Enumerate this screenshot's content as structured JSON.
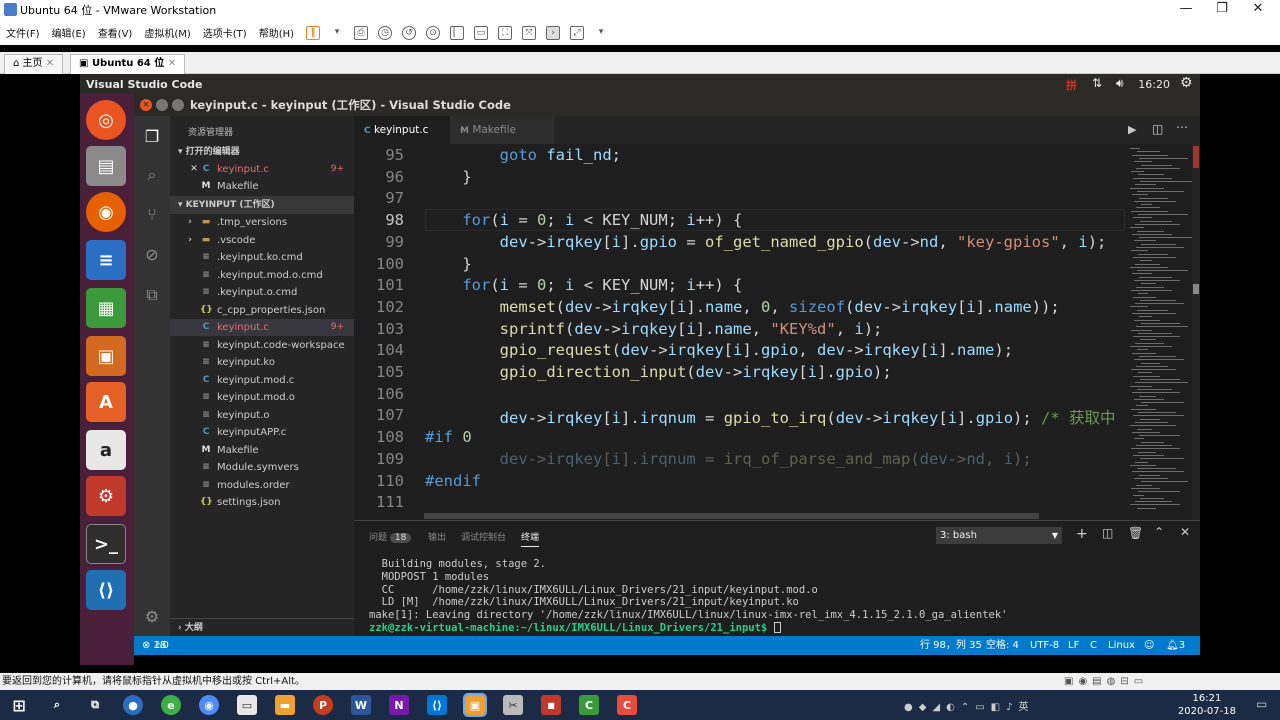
{
  "vmware": {
    "title": "Ubuntu 64 位 - VMware Workstation",
    "menu": [
      "文件(F)",
      "编辑(E)",
      "查看(V)",
      "虚拟机(M)",
      "选项卡(T)",
      "帮助(H)"
    ],
    "tabs": [
      {
        "label": "主页"
      },
      {
        "label": "Ubuntu 64 位"
      }
    ],
    "status_hint": "要返回到您的计算机，请将鼠标指针从虚拟机中移出或按 Ctrl+Alt。"
  },
  "ubuntu": {
    "app_name": "Visual Studio Code",
    "time": "16:20"
  },
  "vscode": {
    "window_title": "keyinput.c - keyinput (工作区) - Visual Studio Code",
    "explorer_header": "资源管理器",
    "open_editors_label": "打开的编辑器",
    "open_editors": [
      {
        "name": "keyinput.c",
        "badge": "9+",
        "icon": "C"
      },
      {
        "name": "Makefile",
        "icon": "M"
      }
    ],
    "workspace_label": "KEYINPUT (工作区)",
    "files": [
      {
        "name": ".tmp_versions",
        "icon": "folder",
        "arrow": "›"
      },
      {
        "name": ".vscode",
        "icon": "folder",
        "arrow": "›"
      },
      {
        "name": ".keyinput.ko.cmd",
        "icon": "file"
      },
      {
        "name": ".keyinput.mod.o.cmd",
        "icon": "file"
      },
      {
        "name": ".keyinput.o.cmd",
        "icon": "file"
      },
      {
        "name": "c_cpp_properties.json",
        "icon": "json"
      },
      {
        "name": "keyinput.c",
        "icon": "C",
        "badge": "9+"
      },
      {
        "name": "keyinput.code-workspace",
        "icon": "file"
      },
      {
        "name": "keyinput.ko",
        "icon": "file"
      },
      {
        "name": "keyinput.mod.c",
        "icon": "C"
      },
      {
        "name": "keyinput.mod.o",
        "icon": "file"
      },
      {
        "name": "keyinput.o",
        "icon": "file"
      },
      {
        "name": "keyinputAPP.c",
        "icon": "C"
      },
      {
        "name": "Makefile",
        "icon": "M"
      },
      {
        "name": "Module.symvers",
        "icon": "file"
      },
      {
        "name": "modules.order",
        "icon": "file"
      },
      {
        "name": "settings.json",
        "icon": "json"
      }
    ],
    "outline_label": "大纲",
    "editor_tabs": [
      {
        "label": "keyinput.c",
        "icon": "C"
      },
      {
        "label": "Makefile",
        "icon": "M"
      }
    ],
    "code_lines": [
      {
        "n": "95",
        "text": "        goto fail_nd;"
      },
      {
        "n": "96",
        "text": "    }"
      },
      {
        "n": "97",
        "text": ""
      },
      {
        "n": "98",
        "text": "    for(i = 0; i < KEY_NUM; i++) {"
      },
      {
        "n": "99",
        "text": "        dev->irqkey[i].gpio = of_get_named_gpio(dev->nd, \"key-gpios\", i);"
      },
      {
        "n": "100",
        "text": "    }"
      },
      {
        "n": "101",
        "text": "    for(i = 0; i < KEY_NUM; i++) {"
      },
      {
        "n": "102",
        "text": "        memset(dev->irqkey[i].name, 0, sizeof(dev->irqkey[i].name));"
      },
      {
        "n": "103",
        "text": "        sprintf(dev->irqkey[i].name, \"KEY%d\", i);"
      },
      {
        "n": "104",
        "text": "        gpio_request(dev->irqkey[i].gpio, dev->irqkey[i].name);"
      },
      {
        "n": "105",
        "text": "        gpio_direction_input(dev->irqkey[i].gpio);"
      },
      {
        "n": "106",
        "text": ""
      },
      {
        "n": "107",
        "text": "        dev->irqkey[i].irqnum = gpio_to_irq(dev->irqkey[i].gpio); /* 获取中"
      },
      {
        "n": "108",
        "text": "#if 0"
      },
      {
        "n": "109",
        "text": "        dev->irqkey[i].irqnum = irq_of_parse_and_map(dev->nd, i);"
      },
      {
        "n": "110",
        "text": "#endif"
      },
      {
        "n": "111",
        "text": ""
      }
    ],
    "panel": {
      "tabs": [
        "问题",
        "输出",
        "调试控制台",
        "终端"
      ],
      "problems_count": "18",
      "terminal_select": "3: bash",
      "terminal_lines": [
        "  Building modules, stage 2.",
        "  MODPOST 1 modules",
        "  CC      /home/zzk/linux/IMX6ULL/Linux_Drivers/21_input/keyinput.mod.o",
        "  LD [M]  /home/zzk/linux/IMX6ULL/Linux_Drivers/21_input/keyinput.ko",
        "make[1]: Leaving directory '/home/zzk/linux/IMX6ULL/linux/linux-imx-rel_imx_4.1.15_2.1.0_ga_alientek'"
      ],
      "prompt": "zzk@zzk-virtual-machine:~/linux/IMX6ULL/Linux_Drivers/21_input$"
    },
    "status": {
      "errors": "18",
      "warnings": "0",
      "position": "行 98，列 35",
      "spaces": "空格: 4",
      "encoding": "UTF-8",
      "eol": "LF",
      "lang_short": "C",
      "platform": "Linux",
      "notifications": "3"
    }
  },
  "taskbar": {
    "time": "16:21",
    "date": "2020-07-18"
  },
  "colors": {
    "statusbar": "#007acc",
    "launcher": "#4a1f3a",
    "editor_bg": "#1e1e1e"
  }
}
